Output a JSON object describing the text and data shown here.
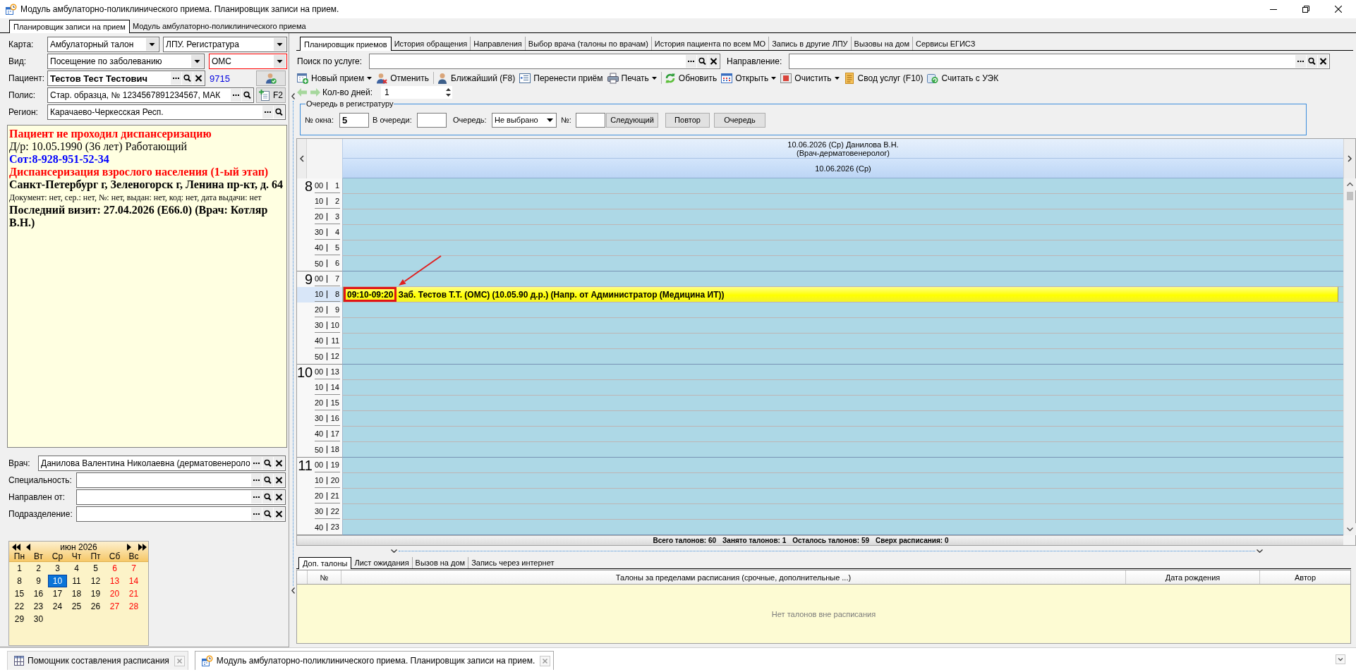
{
  "window": {
    "title": "Модуль амбулаторно-поликлинического приема. Планировщик записи на прием."
  },
  "main_tabs": [
    {
      "label": "Планировщик записи на прием",
      "selected": true
    },
    {
      "label": "Модуль амбулаторно-поликлинического приема",
      "selected": false
    }
  ],
  "patient_form": {
    "card": {
      "label": "Карта:",
      "value": "Амбулаторный талон"
    },
    "registry": {
      "value": "ЛПУ. Регистратура"
    },
    "visit_type": {
      "label": "Вид:",
      "value": "Посещение по заболеванию"
    },
    "payment": {
      "value": "ОМС",
      "invalid": true
    },
    "patient": {
      "label": "Пациент:",
      "value": "Тестов Тест Тестович",
      "code": "9715"
    },
    "policy": {
      "label": "Полис:",
      "value": "Стар. образца, № 1234567891234567, МАК",
      "button": "F2"
    },
    "region": {
      "label": "Регион:",
      "value": "Карачаево-Черкесская Респ."
    }
  },
  "patient_info": [
    {
      "kind": "warning",
      "text": "Пациент не проходил диспансеризацию"
    },
    {
      "kind": "normal",
      "text": "Д/р: 10.05.1990 (36 лет) Работающий"
    },
    {
      "kind": "contact",
      "text": "Сот:8-928-951-52-34"
    },
    {
      "kind": "warning",
      "text": "Диспансеризация взрослого населения (1-ый этап)"
    },
    {
      "kind": "heading",
      "text": "Санкт-Петербург г, Зеленогорск г, Ленина пр-кт, д. 64"
    },
    {
      "kind": "note",
      "text": "Документ: нет, сер.: нет, №: нет, выдан: нет, код: нет, дата выдачи: нет"
    },
    {
      "kind": "heading",
      "text": "Последний визит: 27.04.2026 (E66.0) (Врач: Котляр В.Н.)"
    }
  ],
  "doctor": {
    "label": "Врач:",
    "value": "Данилова Валентина Николаевна (дерматовенероло"
  },
  "filters": [
    {
      "label": "Специальность:"
    },
    {
      "label": "Направлен от:"
    },
    {
      "label": "Подразделение:"
    }
  ],
  "calendar": {
    "month": "июн 2026",
    "weekdays": [
      "Пн",
      "Вт",
      "Ср",
      "Чт",
      "Пт",
      "Сб",
      "Вс"
    ],
    "days": [
      {
        "label": "1",
        "weekend": false,
        "selected": false
      },
      {
        "label": "2",
        "weekend": false,
        "selected": false
      },
      {
        "label": "3",
        "weekend": false,
        "selected": false
      },
      {
        "label": "4",
        "weekend": false,
        "selected": false
      },
      {
        "label": "5",
        "weekend": false,
        "selected": false
      },
      {
        "label": "6",
        "weekend": true,
        "selected": false
      },
      {
        "label": "7",
        "weekend": true,
        "selected": false
      },
      {
        "label": "8",
        "weekend": false,
        "selected": false
      },
      {
        "label": "9",
        "weekend": false,
        "selected": false
      },
      {
        "label": "10",
        "weekend": false,
        "selected": true
      },
      {
        "label": "11",
        "weekend": false,
        "selected": false
      },
      {
        "label": "12",
        "weekend": false,
        "selected": false
      },
      {
        "label": "13",
        "weekend": true,
        "selected": false
      },
      {
        "label": "14",
        "weekend": true,
        "selected": false
      },
      {
        "label": "15",
        "weekend": false,
        "selected": false
      },
      {
        "label": "16",
        "weekend": false,
        "selected": false
      },
      {
        "label": "17",
        "weekend": false,
        "selected": false
      },
      {
        "label": "18",
        "weekend": false,
        "selected": false
      },
      {
        "label": "19",
        "weekend": false,
        "selected": false
      },
      {
        "label": "20",
        "weekend": true,
        "selected": false
      },
      {
        "label": "21",
        "weekend": true,
        "selected": false
      },
      {
        "label": "22",
        "weekend": false,
        "selected": false
      },
      {
        "label": "23",
        "weekend": false,
        "selected": false
      },
      {
        "label": "24",
        "weekend": false,
        "selected": false
      },
      {
        "label": "25",
        "weekend": false,
        "selected": false
      },
      {
        "label": "26",
        "weekend": false,
        "selected": false
      },
      {
        "label": "27",
        "weekend": true,
        "selected": false
      },
      {
        "label": "28",
        "weekend": true,
        "selected": false
      },
      {
        "label": "29",
        "weekend": false,
        "selected": false
      },
      {
        "label": "30",
        "weekend": false,
        "selected": false
      }
    ]
  },
  "scheduler_tabs": [
    {
      "label": "Планировщик приемов",
      "selected": true
    },
    {
      "label": "История обращения",
      "selected": false
    },
    {
      "label": "Направления",
      "selected": false
    },
    {
      "label": "Выбор врача (талоны по врачам)",
      "selected": false
    },
    {
      "label": "История пациента по всем МО",
      "selected": false
    },
    {
      "label": "Запись в другие ЛПУ",
      "selected": false
    },
    {
      "label": "Вызовы на дом",
      "selected": false
    },
    {
      "label": "Сервисы ЕГИСЗ",
      "selected": false
    }
  ],
  "search_bar": {
    "service_label": "Поиск по услуге:",
    "referral_label": "Направление:"
  },
  "toolbar": [
    [
      {
        "label": "Новый прием",
        "dropdown": true
      },
      {
        "label": "Отменить",
        "dropdown": false
      }
    ],
    [
      {
        "label": "Ближайший (F8)",
        "dropdown": false
      },
      {
        "label": "Перенести приём",
        "dropdown": false
      },
      {
        "label": "Печать",
        "dropdown": true
      }
    ],
    [
      {
        "label": "Обновить",
        "dropdown": false
      },
      {
        "label": "Открыть",
        "dropdown": true
      },
      {
        "label": "Очистить",
        "dropdown": true
      },
      {
        "label": "Свод услуг (F10)",
        "dropdown": false
      },
      {
        "label": "Считать с УЭК",
        "dropdown": false
      }
    ]
  ],
  "days": {
    "label": "Кол-во дней:",
    "value": "1"
  },
  "queue": {
    "title": "Очередь в регистратуру",
    "window": {
      "label": "№ окна:",
      "value": "5"
    },
    "waiting": {
      "label": "В очереди:"
    },
    "queue": {
      "label": "Очередь:",
      "value": "Не выбрано"
    },
    "number": {
      "label": "№:"
    },
    "buttons": [
      "Следующий",
      "Повтор",
      "Очередь"
    ]
  },
  "schedule": {
    "doctor_header": "10.06.2026 (Ср) Данилова В.Н.",
    "doctor_specialty": "(Врач-дерматовенеролог)",
    "date_header": "10.06.2026 (Ср)",
    "hours": [
      {
        "hour": "8",
        "slots": [
          {
            "minute": "00",
            "number": "1",
            "selected": false
          },
          {
            "minute": "10",
            "number": "2",
            "selected": false
          },
          {
            "minute": "20",
            "number": "3",
            "selected": false
          },
          {
            "minute": "30",
            "number": "4",
            "selected": false
          },
          {
            "minute": "40",
            "number": "5",
            "selected": false
          },
          {
            "minute": "50",
            "number": "6",
            "selected": false
          }
        ]
      },
      {
        "hour": "9",
        "slots": [
          {
            "minute": "00",
            "number": "7",
            "selected": false
          },
          {
            "minute": "10",
            "number": "8",
            "selected": true,
            "appointment": {
              "time": "09:10-09:20",
              "text": "Заб. Тестов Т.Т. (ОМС) (10.05.90 д.р.) (Напр. от Администратор (Медицина ИТ))",
              "annotated": true
            }
          },
          {
            "minute": "20",
            "number": "9",
            "selected": false
          },
          {
            "minute": "30",
            "number": "10",
            "selected": false
          },
          {
            "minute": "40",
            "number": "11",
            "selected": false
          },
          {
            "minute": "50",
            "number": "12",
            "selected": false
          }
        ]
      },
      {
        "hour": "10",
        "slots": [
          {
            "minute": "00",
            "number": "13",
            "selected": false
          },
          {
            "minute": "10",
            "number": "14",
            "selected": false
          },
          {
            "minute": "20",
            "number": "15",
            "selected": false
          },
          {
            "minute": "30",
            "number": "16",
            "selected": false
          },
          {
            "minute": "40",
            "number": "17",
            "selected": false
          },
          {
            "minute": "50",
            "number": "18",
            "selected": false
          }
        ]
      },
      {
        "hour": "11",
        "slots": [
          {
            "minute": "00",
            "number": "19",
            "selected": false
          },
          {
            "minute": "10",
            "number": "20",
            "selected": false
          },
          {
            "minute": "20",
            "number": "21",
            "selected": false
          },
          {
            "minute": "30",
            "number": "22",
            "selected": false
          },
          {
            "minute": "40",
            "number": "23",
            "selected": false
          }
        ]
      }
    ],
    "summary": [
      "Всего талонов: 60",
      "Занято талонов: 1",
      "Осталось талонов: 59",
      "Сверх расписания: 0"
    ]
  },
  "extra_tabs": [
    {
      "label": "Доп. талоны",
      "selected": true
    },
    {
      "label": "Лист ожидания",
      "selected": false
    },
    {
      "label": "Вызов на дом",
      "selected": false
    },
    {
      "label": "Запись через интернет",
      "selected": false
    }
  ],
  "extra_table": {
    "columns": [
      "№",
      "Талоны за пределами расписания (срочные, дополнительные ...)",
      "Дата рождения",
      "Автор"
    ],
    "empty_message": "Нет талонов вне расписания"
  },
  "taskbar": [
    {
      "label": "Помощник составления расписания",
      "selected": false
    },
    {
      "label": "Модуль амбулаторно-поликлинического приема. Планировщик записи на прием.",
      "selected": true
    }
  ]
}
